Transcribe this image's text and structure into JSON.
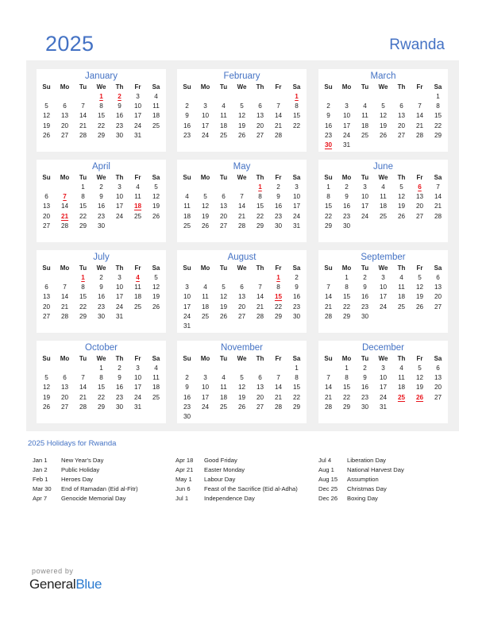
{
  "header": {
    "year": "2025",
    "country": "Rwanda"
  },
  "weekdays": [
    "Su",
    "Mo",
    "Tu",
    "We",
    "Th",
    "Fr",
    "Sa"
  ],
  "months": [
    {
      "name": "January",
      "start": 3,
      "days": 31,
      "holidays": [
        1,
        2
      ]
    },
    {
      "name": "February",
      "start": 6,
      "days": 28,
      "holidays": [
        1
      ]
    },
    {
      "name": "March",
      "start": 6,
      "days": 31,
      "holidays": [
        30
      ]
    },
    {
      "name": "April",
      "start": 2,
      "days": 30,
      "holidays": [
        7,
        18,
        21
      ]
    },
    {
      "name": "May",
      "start": 4,
      "days": 31,
      "holidays": [
        1
      ]
    },
    {
      "name": "June",
      "start": 0,
      "days": 30,
      "holidays": [
        6
      ]
    },
    {
      "name": "July",
      "start": 2,
      "days": 31,
      "holidays": [
        1,
        4
      ]
    },
    {
      "name": "August",
      "start": 5,
      "days": 31,
      "holidays": [
        1,
        15
      ]
    },
    {
      "name": "September",
      "start": 1,
      "days": 30,
      "holidays": []
    },
    {
      "name": "October",
      "start": 3,
      "days": 31,
      "holidays": []
    },
    {
      "name": "November",
      "start": 6,
      "days": 30,
      "holidays": []
    },
    {
      "name": "December",
      "start": 1,
      "days": 31,
      "holidays": [
        25,
        26
      ]
    }
  ],
  "holidays_title": "2025 Holidays for Rwanda",
  "holiday_columns": [
    [
      {
        "date": "Jan 1",
        "name": "New Year's Day"
      },
      {
        "date": "Jan 2",
        "name": "Public Holiday"
      },
      {
        "date": "Feb 1",
        "name": "Heroes Day"
      },
      {
        "date": "Mar 30",
        "name": "End of Ramadan (Eid al-Fitr)"
      },
      {
        "date": "Apr 7",
        "name": "Genocide Memorial Day"
      }
    ],
    [
      {
        "date": "Apr 18",
        "name": "Good Friday"
      },
      {
        "date": "Apr 21",
        "name": "Easter Monday"
      },
      {
        "date": "May 1",
        "name": "Labour Day"
      },
      {
        "date": "Jun 6",
        "name": "Feast of the Sacrifice (Eid al-Adha)"
      },
      {
        "date": "Jul 1",
        "name": "Independence Day"
      }
    ],
    [
      {
        "date": "Jul 4",
        "name": "Liberation Day"
      },
      {
        "date": "Aug 1",
        "name": "National Harvest Day"
      },
      {
        "date": "Aug 15",
        "name": "Assumption"
      },
      {
        "date": "Dec 25",
        "name": "Christmas Day"
      },
      {
        "date": "Dec 26",
        "name": "Boxing Day"
      }
    ]
  ],
  "footer": {
    "powered_by": "powered by",
    "brand_part1": "General",
    "brand_part2": "Blue"
  },
  "colors": {
    "accent": "#4472c4",
    "holiday": "#e8141b",
    "panel": "#f0f0f0",
    "brand_blue": "#2b7bd0"
  }
}
